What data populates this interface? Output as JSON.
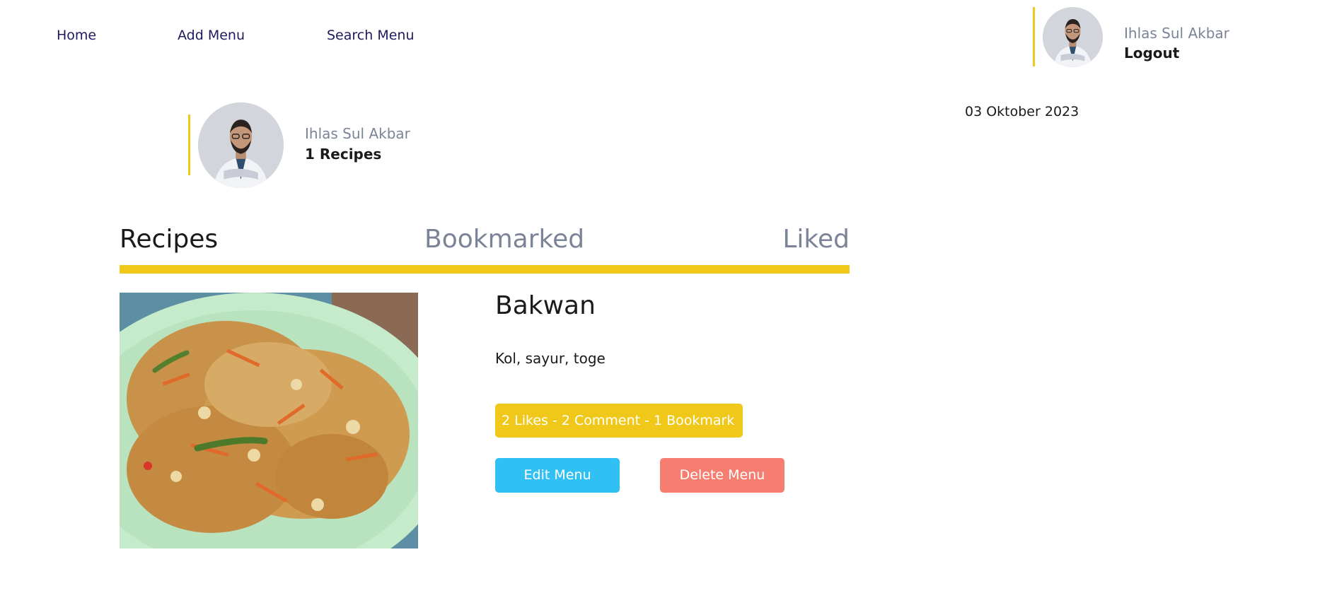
{
  "nav": {
    "home": "Home",
    "add_menu": "Add Menu",
    "search_menu": "Search Menu"
  },
  "user": {
    "name": "Ihlas Sul Akbar",
    "logout": "Logout"
  },
  "profile": {
    "name": "Ihlas Sul Akbar",
    "recipe_count": "1 Recipes"
  },
  "date": "03 Oktober 2023",
  "tabs": {
    "recipes": "Recipes",
    "bookmarked": "Bookmarked",
    "liked": "Liked",
    "active": "Recipes"
  },
  "recipe": {
    "title": "Bakwan",
    "ingredients": "Kol, sayur, toge",
    "stats": "2 Likes - 2 Comment - 1 Bookmark",
    "edit_label": "Edit Menu",
    "delete_label": "Delete Menu"
  },
  "colors": {
    "accent": "#efc81a",
    "edit": "#30c0f3",
    "delete": "#f57e71",
    "muted": "#7b8497",
    "nav": "#1f1a5c"
  }
}
